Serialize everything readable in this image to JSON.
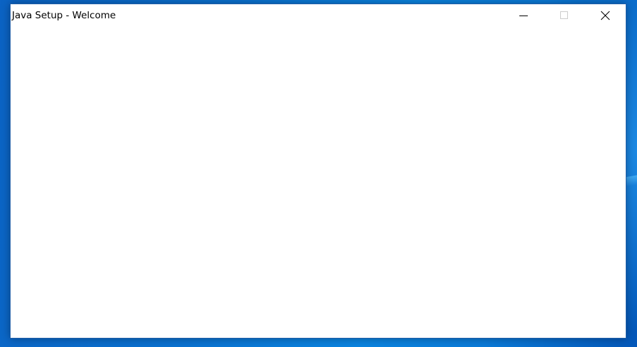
{
  "window": {
    "title": "Java Setup - Welcome",
    "controls": {
      "minimize": "minimize",
      "maximize": "maximize",
      "close": "close"
    }
  },
  "icons": {
    "minimize": "minimize-icon",
    "maximize": "maximize-icon",
    "close": "close-icon"
  },
  "colors": {
    "desktop": "#0a78d4",
    "window_background": "#ffffff",
    "window_border": "#1f5ea8",
    "title_text": "#000000",
    "maximize_disabled": "#cccccc"
  }
}
